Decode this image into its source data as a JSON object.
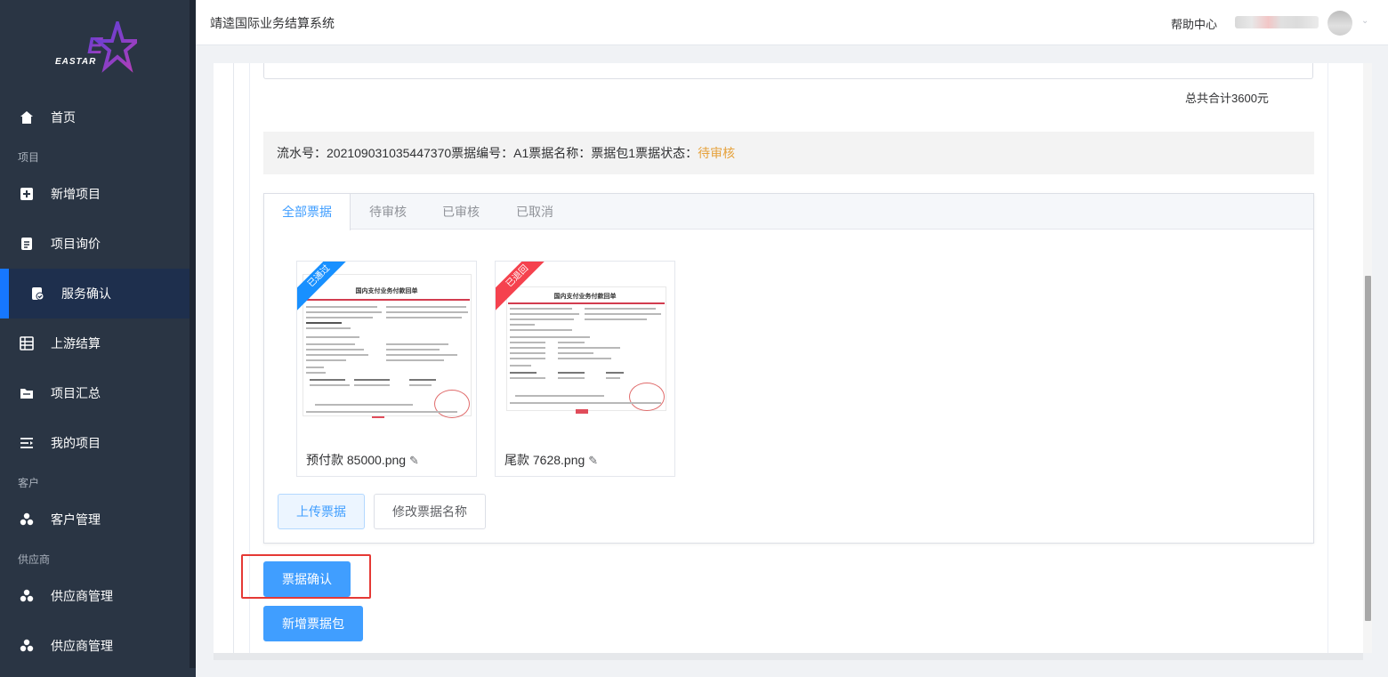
{
  "app": {
    "title": "靖逵国际业务结算系统",
    "logo_text": "EASTAR"
  },
  "header": {
    "help_label": "帮助中心",
    "caret": "⌄"
  },
  "sidebar": {
    "items": [
      {
        "label": "首页",
        "icon": "home-icon"
      },
      {
        "group": "项目"
      },
      {
        "label": "新增项目",
        "icon": "plus-square-icon"
      },
      {
        "label": "项目询价",
        "icon": "document-icon"
      },
      {
        "label": "服务确认",
        "icon": "check-document-icon",
        "active": true
      },
      {
        "label": "上游结算",
        "icon": "grid-icon"
      },
      {
        "label": "项目汇总",
        "icon": "folder-icon"
      },
      {
        "label": "我的项目",
        "icon": "list-icon"
      },
      {
        "group": "客户"
      },
      {
        "label": "客户管理",
        "icon": "cluster-icon"
      },
      {
        "group": "供应商"
      },
      {
        "label": "供应商管理",
        "icon": "cluster-icon"
      },
      {
        "label": "供应商管理",
        "icon": "cluster-icon"
      }
    ]
  },
  "main": {
    "total_text": "总共合计3600元",
    "info": {
      "serial_label": "流水号：",
      "serial": "202109031035447370",
      "bill_no_label": " 票据编号：",
      "bill_no": "A1",
      "bill_name_label": " 票据名称：",
      "bill_name": "票据包1",
      "status_label": " 票据状态：",
      "status": "待审核"
    },
    "tabs": [
      "全部票据",
      "待审核",
      "已审核",
      "已取消"
    ],
    "files": [
      {
        "name": "预付款 85000.png",
        "badge": "已通过",
        "badge_color": "#1890ff",
        "doc_title": "国内支付业务付款回单"
      },
      {
        "name": "尾款 7628.png",
        "badge": "已退回",
        "badge_color": "#f5424e",
        "doc_title": "国内支付业务付款回单"
      }
    ],
    "edit_icon": "✎",
    "buttons": {
      "upload": "上传票据",
      "rename": "修改票据名称",
      "confirm": "票据确认",
      "new_package": "新增票据包"
    }
  }
}
